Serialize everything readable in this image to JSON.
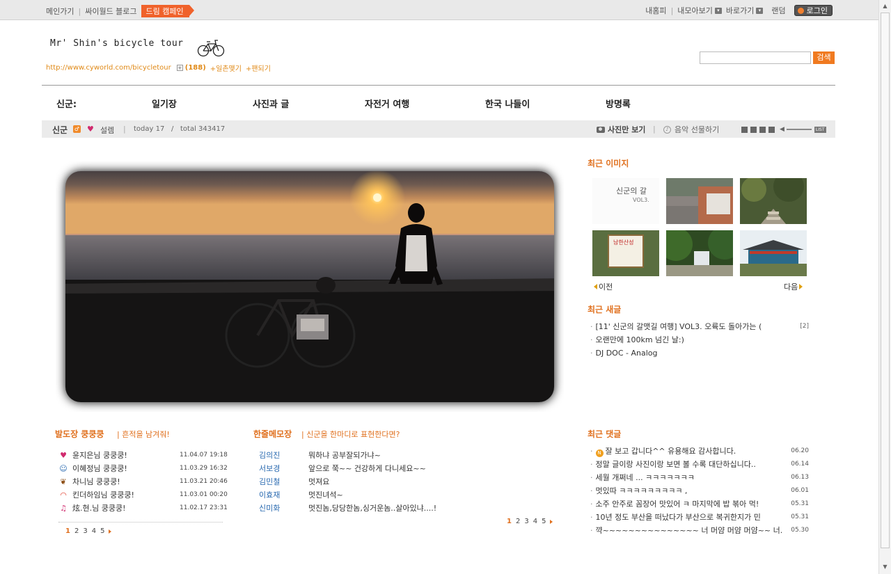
{
  "topbar": {
    "links": [
      "메인가기",
      "싸이월드 블로그"
    ],
    "dream": "드림 캠페인",
    "right": [
      "내홈피",
      "내모아보기",
      "바로가기",
      "랜덤"
    ],
    "login": "로그인"
  },
  "header": {
    "logo": "Mr' Shin's bicycle tour",
    "url": "http://www.cyworld.com/bicycletour",
    "fan_count": "(188)",
    "link1": "일촌맺기",
    "link2": "팬되기",
    "search_button": "검색"
  },
  "nav": [
    "신군:",
    "일기장",
    "사진과 글",
    "자전거 여행",
    "한국 나들이",
    "방명록"
  ],
  "status": {
    "owner": "신군",
    "mood": "설렘",
    "today": "today 17",
    "slash": "/",
    "total": "total 343417",
    "photo_only": "사진만 보기",
    "music_gift": "음악 선물하기",
    "list": "LIST"
  },
  "recent_images": {
    "title": "최근 이미지",
    "thumb1_text": "신군의 갈",
    "thumb1_sub": "VOL3.",
    "thumb4_text": "남한산성",
    "prev": "이전",
    "next": "다음"
  },
  "recent_posts": {
    "title": "최근 새글",
    "items": [
      {
        "text": "[11' 신군의 갈맷길 여행] VOL3. 오륙도 돌아가는 (",
        "count": "[2]"
      },
      {
        "text": "오랜만에 100km 넘긴 날:)",
        "count": ""
      },
      {
        "text": "DJ DOC - Analog",
        "count": ""
      }
    ]
  },
  "recent_comments": {
    "title": "최근 댓글",
    "new_badge": "N",
    "items": [
      {
        "text": "잘 보고 갑니다^^ 유용해요 감사합니다.",
        "date": "06.20"
      },
      {
        "text": "정말 글이랑 사진이랑 보면 볼 수록 대단하십니다..",
        "date": "06.14"
      },
      {
        "text": "세월 개쩌네 ... ㅋㅋㅋㅋㅋㅋㅋ",
        "date": "06.13"
      },
      {
        "text": "멋있따 ㅋㅋㅋㅋㅋㅋㅋㅋㅋ ,",
        "date": "06.01"
      },
      {
        "text": "소주 안주로 꼼장어 맛있어 ㅋ 마지막에 밥 볶아 먹!",
        "date": "05.31"
      },
      {
        "text": "10년 정도 부산을 떠났다가 부산으로 복귀한지가 민",
        "date": "05.31"
      },
      {
        "text": "꺅~~~~~~~~~~~~~~~ 너 머얌 머얌 머얌~~ 너.",
        "date": "05.30"
      }
    ]
  },
  "guestbook": {
    "title": "발도장 쿵쿵쿵",
    "subtitle": "흔적을 남겨줘!",
    "items": [
      {
        "icon": "heart-icon",
        "glyph": "♥",
        "color": "#d02a6e",
        "text": "윤지은님 쿵쿵쿵!",
        "date": "11.04.07 19:18"
      },
      {
        "icon": "cat-face-icon",
        "glyph": "☺",
        "color": "#2a6ab0",
        "text": "이혜정님 쿵쿵쿵!",
        "date": "11.03.29 16:32"
      },
      {
        "icon": "paw-icon",
        "glyph": "❦",
        "color": "#8a4a10",
        "text": "차니님 쿵쿵쿵!",
        "date": "11.03.21 20:46"
      },
      {
        "icon": "rainbow-icon",
        "glyph": "◠",
        "color": "#e03a2a",
        "text": "킨더하임님 쿵쿵쿵!",
        "date": "11.03.01 00:20"
      },
      {
        "icon": "music-note-icon",
        "glyph": "♫",
        "color": "#d02a6e",
        "text": "炫.현.님 쿵쿵쿵!",
        "date": "11.02.17 23:31"
      }
    ],
    "pages": [
      "1",
      "2",
      "3",
      "4",
      "5"
    ]
  },
  "memo": {
    "title": "한줄메모장",
    "subtitle": "신군을 한마디로 표현한다면?",
    "items": [
      {
        "name": "김의진",
        "text": "뭐하냐 공부잘되가냐~"
      },
      {
        "name": "서보경",
        "text": "앞으로 쭉~~ 건강하게 다니세요~~"
      },
      {
        "name": "김민철",
        "text": "멋져요"
      },
      {
        "name": "이효재",
        "text": "멋진녀석~"
      },
      {
        "name": "신미화",
        "text": "멋진놈,당당한놈,싱거운놈..살아있냐....!"
      }
    ],
    "pages": [
      "1",
      "2",
      "3",
      "4",
      "5"
    ]
  }
}
